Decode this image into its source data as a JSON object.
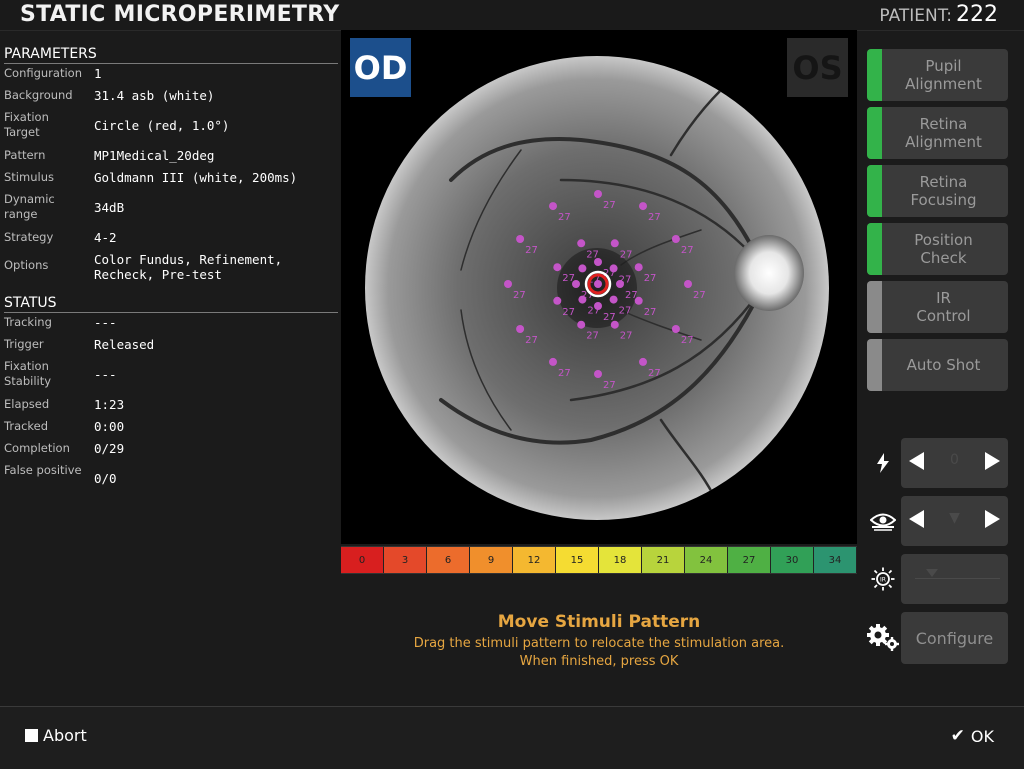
{
  "header": {
    "title": "STATIC MICROPERIMETRY",
    "patient_label": "PATIENT:",
    "patient_id": "222"
  },
  "parameters": {
    "title": "PARAMETERS",
    "rows": [
      {
        "label": "Configuration",
        "value": "1"
      },
      {
        "label": "Background",
        "value": "31.4 asb (white)"
      },
      {
        "label": "Fixation Target",
        "value": "Circle (red, 1.0°)"
      },
      {
        "label": "Pattern",
        "value": "MP1Medical_20deg"
      },
      {
        "label": "Stimulus",
        "value": "Goldmann III (white, 200ms)"
      },
      {
        "label": "Dynamic range",
        "value": "34dB"
      },
      {
        "label": "Strategy",
        "value": "4-2"
      },
      {
        "label": "Options",
        "value": "Color Fundus, Refinement, Recheck, Pre-test"
      }
    ]
  },
  "status": {
    "title": "STATUS",
    "rows": [
      {
        "label": "Tracking",
        "value": "---"
      },
      {
        "label": "Trigger",
        "value": "Released"
      },
      {
        "label": "Fixation Stability",
        "value": "---"
      },
      {
        "label": "Elapsed",
        "value": "1:23"
      },
      {
        "label": "Tracked",
        "value": "0:00"
      },
      {
        "label": "Completion",
        "value": "0/29"
      },
      {
        "label": "False positive",
        "value": "0/0"
      }
    ]
  },
  "viewer": {
    "od_label": "OD",
    "os_label": "OS",
    "stimulus_value": "27",
    "stimulus_color": "#c455c8",
    "fixation_color": "#e02020"
  },
  "scale": {
    "values": [
      "0",
      "3",
      "6",
      "9",
      "12",
      "15",
      "18",
      "21",
      "24",
      "27",
      "30",
      "34"
    ],
    "colors": [
      "#d81f1f",
      "#e4492a",
      "#ec6c2c",
      "#f08f2c",
      "#f4b830",
      "#f5dc32",
      "#e4e43a",
      "#b8d43c",
      "#82c23e",
      "#4fb044",
      "#31a057",
      "#2c9470"
    ]
  },
  "instructions": {
    "title": "Move Stimuli Pattern",
    "line1": "Drag the stimuli pattern to relocate the stimulation area.",
    "line2": "When finished, press OK"
  },
  "steps": [
    {
      "label": "Pupil\nAlignment",
      "stripe": "#33b34a"
    },
    {
      "label": "Retina\nAlignment",
      "stripe": "#33b34a"
    },
    {
      "label": "Retina\nFocusing",
      "stripe": "#33b34a"
    },
    {
      "label": "Position\nCheck",
      "stripe": "#33b34a"
    },
    {
      "label": "IR\nControl",
      "stripe": "#8a8a8a"
    },
    {
      "label": "Auto Shot",
      "stripe": "#8a8a8a"
    }
  ],
  "controls": {
    "flash_value": "0",
    "eye_value": "▼",
    "configure_label": "Configure"
  },
  "footer": {
    "abort_label": "Abort",
    "ok_label": "OK"
  }
}
